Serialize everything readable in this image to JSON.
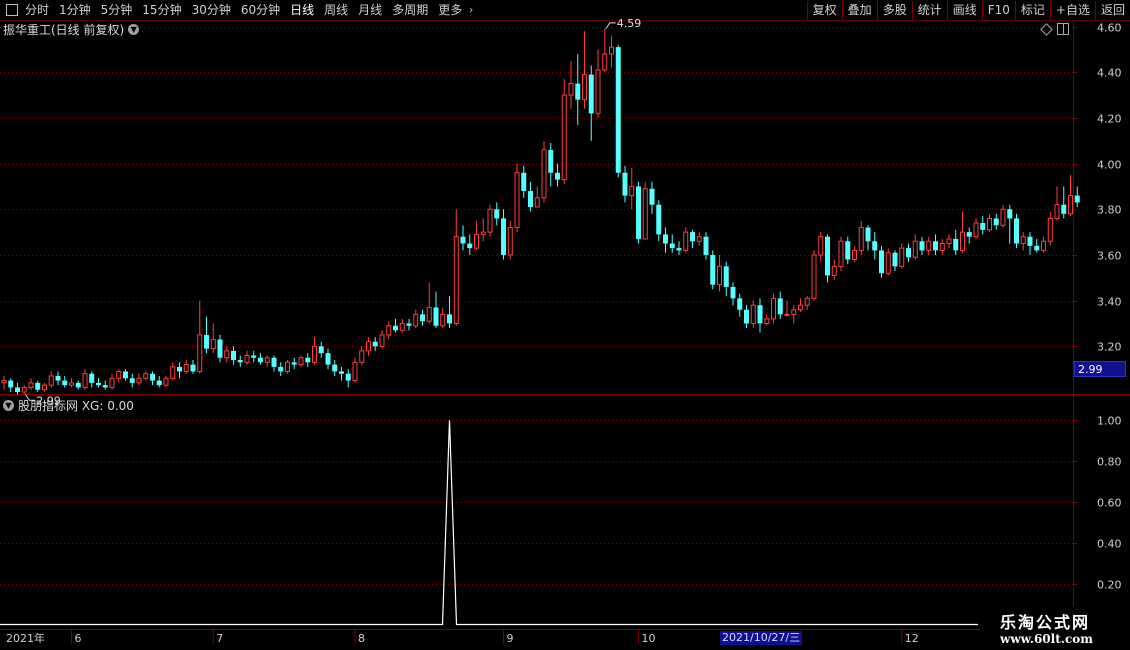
{
  "toolbar": {
    "left": [
      {
        "label": "分时"
      },
      {
        "label": "1分钟"
      },
      {
        "label": "5分钟"
      },
      {
        "label": "15分钟"
      },
      {
        "label": "30分钟"
      },
      {
        "label": "60分钟"
      },
      {
        "label": "日线",
        "active": true
      },
      {
        "label": "周线"
      },
      {
        "label": "月线"
      },
      {
        "label": "多周期"
      },
      {
        "label": "更多"
      }
    ],
    "right": [
      {
        "label": "复权"
      },
      {
        "label": "叠加"
      },
      {
        "label": "多股"
      },
      {
        "label": "统计"
      },
      {
        "label": "画线"
      },
      {
        "label": "F10"
      },
      {
        "label": "标记"
      },
      {
        "label": "+自选"
      },
      {
        "label": "返回"
      }
    ]
  },
  "main_panel": {
    "title": "振华重工(日线 前复权)",
    "price_tag": "2.99"
  },
  "sub_panel": {
    "title": "股朋指标网 XG: 0.00"
  },
  "date_axis": {
    "cursor_date": "2021/10/27/三"
  },
  "watermark": {
    "line1": "乐淘公式网",
    "line2": "www.60lt.com"
  },
  "colors": {
    "up": "#ff3c3c",
    "down": "#54ffff",
    "grid": "#800000",
    "axis_text": "#cfcfcf",
    "indicator_line": "#ffffff"
  },
  "chart_data": [
    {
      "type": "candlestick",
      "title": "振华重工(日线 前复权)",
      "y_ticks": [
        "3.20",
        "3.40",
        "3.60",
        "3.80",
        "4.00",
        "4.20",
        "4.40",
        "4.60"
      ],
      "ylim": [
        3.0,
        4.62
      ],
      "months": [
        {
          "label": "2021年",
          "index": 0
        },
        {
          "label": "6",
          "index": 10
        },
        {
          "label": "7",
          "index": 31
        },
        {
          "label": "8",
          "index": 52
        },
        {
          "label": "9",
          "index": 74
        },
        {
          "label": "10",
          "index": 94
        },
        {
          "label": "12",
          "index": 133
        }
      ],
      "annotations": [
        {
          "text": "4.59",
          "index": 89,
          "price": 4.59
        },
        {
          "text": "2.99",
          "index": 3,
          "price": 2.99
        }
      ],
      "candles": [
        [
          3.04,
          3.05,
          3.07,
          3.01
        ],
        [
          3.05,
          3.02,
          3.06,
          3.0
        ],
        [
          3.02,
          3.0,
          3.04,
          2.99
        ],
        [
          3.0,
          3.02,
          3.03,
          2.99
        ],
        [
          3.02,
          3.04,
          3.06,
          3.01
        ],
        [
          3.04,
          3.01,
          3.05,
          3.0
        ],
        [
          3.01,
          3.03,
          3.04,
          3.0
        ],
        [
          3.03,
          3.07,
          3.09,
          3.02
        ],
        [
          3.07,
          3.05,
          3.09,
          3.03
        ],
        [
          3.05,
          3.03,
          3.07,
          3.02
        ],
        [
          3.03,
          3.04,
          3.06,
          3.02
        ],
        [
          3.04,
          3.02,
          3.05,
          3.01
        ],
        [
          3.02,
          3.08,
          3.1,
          3.01
        ],
        [
          3.08,
          3.04,
          3.09,
          3.02
        ],
        [
          3.04,
          3.03,
          3.06,
          3.02
        ],
        [
          3.03,
          3.02,
          3.05,
          3.01
        ],
        [
          3.02,
          3.06,
          3.08,
          3.01
        ],
        [
          3.06,
          3.09,
          3.1,
          3.04
        ],
        [
          3.09,
          3.06,
          3.1,
          3.05
        ],
        [
          3.06,
          3.04,
          3.08,
          3.02
        ],
        [
          3.04,
          3.06,
          3.08,
          3.03
        ],
        [
          3.06,
          3.08,
          3.09,
          3.05
        ],
        [
          3.08,
          3.05,
          3.09,
          3.03
        ],
        [
          3.05,
          3.03,
          3.07,
          3.02
        ],
        [
          3.03,
          3.06,
          3.07,
          3.02
        ],
        [
          3.06,
          3.11,
          3.13,
          3.05
        ],
        [
          3.11,
          3.09,
          3.13,
          3.06
        ],
        [
          3.09,
          3.12,
          3.14,
          3.08
        ],
        [
          3.12,
          3.09,
          3.14,
          3.08
        ],
        [
          3.09,
          3.25,
          3.4,
          3.08
        ],
        [
          3.25,
          3.19,
          3.33,
          3.17
        ],
        [
          3.19,
          3.23,
          3.3,
          3.17
        ],
        [
          3.23,
          3.15,
          3.25,
          3.13
        ],
        [
          3.15,
          3.18,
          3.2,
          3.13
        ],
        [
          3.18,
          3.14,
          3.2,
          3.12
        ],
        [
          3.14,
          3.13,
          3.16,
          3.11
        ],
        [
          3.13,
          3.16,
          3.18,
          3.12
        ],
        [
          3.16,
          3.15,
          3.18,
          3.13
        ],
        [
          3.15,
          3.13,
          3.17,
          3.12
        ],
        [
          3.13,
          3.15,
          3.16,
          3.11
        ],
        [
          3.15,
          3.11,
          3.16,
          3.09
        ],
        [
          3.11,
          3.09,
          3.13,
          3.07
        ],
        [
          3.09,
          3.13,
          3.14,
          3.08
        ],
        [
          3.13,
          3.12,
          3.15,
          3.1
        ],
        [
          3.12,
          3.15,
          3.16,
          3.11
        ],
        [
          3.15,
          3.13,
          3.17,
          3.11
        ],
        [
          3.13,
          3.2,
          3.24,
          3.12
        ],
        [
          3.2,
          3.17,
          3.22,
          3.15
        ],
        [
          3.17,
          3.12,
          3.19,
          3.1
        ],
        [
          3.12,
          3.09,
          3.14,
          3.07
        ],
        [
          3.09,
          3.08,
          3.11,
          3.05
        ],
        [
          3.08,
          3.05,
          3.1,
          3.02
        ],
        [
          3.05,
          3.13,
          3.15,
          3.04
        ],
        [
          3.13,
          3.18,
          3.2,
          3.12
        ],
        [
          3.18,
          3.22,
          3.24,
          3.16
        ],
        [
          3.22,
          3.2,
          3.24,
          3.18
        ],
        [
          3.2,
          3.25,
          3.27,
          3.19
        ],
        [
          3.25,
          3.29,
          3.31,
          3.23
        ],
        [
          3.29,
          3.27,
          3.32,
          3.26
        ],
        [
          3.27,
          3.3,
          3.32,
          3.26
        ],
        [
          3.3,
          3.29,
          3.32,
          3.27
        ],
        [
          3.29,
          3.34,
          3.36,
          3.28
        ],
        [
          3.34,
          3.31,
          3.36,
          3.29
        ],
        [
          3.31,
          3.37,
          3.48,
          3.3
        ],
        [
          3.37,
          3.29,
          3.44,
          3.28
        ],
        [
          3.29,
          3.34,
          3.37,
          3.28
        ],
        [
          3.34,
          3.3,
          3.42,
          3.28
        ],
        [
          3.3,
          3.68,
          3.8,
          3.29
        ],
        [
          3.68,
          3.65,
          3.73,
          3.62
        ],
        [
          3.65,
          3.63,
          3.69,
          3.6
        ],
        [
          3.63,
          3.69,
          3.75,
          3.62
        ],
        [
          3.69,
          3.7,
          3.76,
          3.66
        ],
        [
          3.7,
          3.8,
          3.82,
          3.68
        ],
        [
          3.8,
          3.76,
          3.83,
          3.73
        ],
        [
          3.76,
          3.6,
          3.8,
          3.58
        ],
        [
          3.6,
          3.72,
          3.75,
          3.58
        ],
        [
          3.72,
          3.96,
          4.0,
          3.7
        ],
        [
          3.96,
          3.88,
          3.99,
          3.85
        ],
        [
          3.88,
          3.81,
          3.92,
          3.79
        ],
        [
          3.81,
          3.85,
          3.9,
          3.82
        ],
        [
          3.85,
          4.06,
          4.1,
          3.83
        ],
        [
          4.06,
          3.96,
          4.09,
          3.9
        ],
        [
          3.96,
          3.93,
          4.0,
          3.9
        ],
        [
          3.93,
          4.3,
          4.37,
          3.91
        ],
        [
          4.3,
          4.35,
          4.45,
          4.24
        ],
        [
          4.35,
          4.28,
          4.48,
          4.17
        ],
        [
          4.28,
          4.39,
          4.58,
          4.24
        ],
        [
          4.39,
          4.22,
          4.43,
          4.1
        ],
        [
          4.22,
          4.41,
          4.5,
          4.2
        ],
        [
          4.41,
          4.48,
          4.59,
          4.4
        ],
        [
          4.48,
          4.51,
          4.56,
          4.42
        ],
        [
          4.51,
          3.96,
          4.52,
          3.94
        ],
        [
          3.96,
          3.86,
          3.99,
          3.83
        ],
        [
          3.86,
          3.9,
          3.98,
          3.8
        ],
        [
          3.9,
          3.67,
          3.92,
          3.65
        ],
        [
          3.67,
          3.89,
          3.92,
          3.7
        ],
        [
          3.89,
          3.82,
          3.92,
          3.78
        ],
        [
          3.82,
          3.69,
          3.84,
          3.66
        ],
        [
          3.69,
          3.65,
          3.72,
          3.61
        ],
        [
          3.65,
          3.63,
          3.69,
          3.61
        ],
        [
          3.63,
          3.62,
          3.66,
          3.6
        ],
        [
          3.62,
          3.7,
          3.72,
          3.61
        ],
        [
          3.7,
          3.66,
          3.71,
          3.63
        ],
        [
          3.66,
          3.68,
          3.7,
          3.64
        ],
        [
          3.68,
          3.6,
          3.7,
          3.58
        ],
        [
          3.6,
          3.47,
          3.62,
          3.45
        ],
        [
          3.47,
          3.55,
          3.6,
          3.44
        ],
        [
          3.55,
          3.46,
          3.57,
          3.42
        ],
        [
          3.46,
          3.41,
          3.48,
          3.38
        ],
        [
          3.41,
          3.36,
          3.43,
          3.33
        ],
        [
          3.36,
          3.3,
          3.38,
          3.28
        ],
        [
          3.3,
          3.38,
          3.4,
          3.28
        ],
        [
          3.38,
          3.3,
          3.41,
          3.26
        ],
        [
          3.3,
          3.32,
          3.34,
          3.29
        ],
        [
          3.32,
          3.41,
          3.43,
          3.3
        ],
        [
          3.41,
          3.34,
          3.44,
          3.32
        ],
        [
          3.34,
          3.34,
          3.4,
          3.33
        ],
        [
          3.34,
          3.36,
          3.38,
          3.3
        ],
        [
          3.36,
          3.38,
          3.41,
          3.35
        ],
        [
          3.38,
          3.41,
          3.42,
          3.36
        ],
        [
          3.41,
          3.6,
          3.62,
          3.4
        ],
        [
          3.6,
          3.68,
          3.7,
          3.57
        ],
        [
          3.68,
          3.51,
          3.69,
          3.48
        ],
        [
          3.51,
          3.55,
          3.58,
          3.49
        ],
        [
          3.55,
          3.66,
          3.68,
          3.53
        ],
        [
          3.66,
          3.58,
          3.68,
          3.56
        ],
        [
          3.58,
          3.62,
          3.64,
          3.57
        ],
        [
          3.62,
          3.72,
          3.75,
          3.6
        ],
        [
          3.72,
          3.66,
          3.73,
          3.62
        ],
        [
          3.66,
          3.62,
          3.7,
          3.58
        ],
        [
          3.62,
          3.52,
          3.64,
          3.5
        ],
        [
          3.52,
          3.61,
          3.63,
          3.51
        ],
        [
          3.61,
          3.55,
          3.62,
          3.53
        ],
        [
          3.55,
          3.63,
          3.65,
          3.54
        ],
        [
          3.63,
          3.59,
          3.65,
          3.57
        ],
        [
          3.59,
          3.66,
          3.69,
          3.58
        ],
        [
          3.66,
          3.62,
          3.68,
          3.6
        ],
        [
          3.62,
          3.66,
          3.68,
          3.6
        ],
        [
          3.66,
          3.62,
          3.69,
          3.6
        ],
        [
          3.62,
          3.65,
          3.67,
          3.6
        ],
        [
          3.65,
          3.67,
          3.69,
          3.63
        ],
        [
          3.67,
          3.62,
          3.71,
          3.6
        ],
        [
          3.62,
          3.7,
          3.79,
          3.61
        ],
        [
          3.7,
          3.68,
          3.72,
          3.65
        ],
        [
          3.68,
          3.74,
          3.76,
          3.67
        ],
        [
          3.74,
          3.71,
          3.77,
          3.69
        ],
        [
          3.71,
          3.76,
          3.78,
          3.7
        ],
        [
          3.76,
          3.73,
          3.78,
          3.71
        ],
        [
          3.73,
          3.8,
          3.82,
          3.72
        ],
        [
          3.8,
          3.76,
          3.82,
          3.65
        ],
        [
          3.76,
          3.65,
          3.78,
          3.63
        ],
        [
          3.65,
          3.68,
          3.7,
          3.62
        ],
        [
          3.68,
          3.64,
          3.7,
          3.6
        ],
        [
          3.64,
          3.62,
          3.67,
          3.61
        ],
        [
          3.62,
          3.66,
          3.68,
          3.61
        ],
        [
          3.66,
          3.76,
          3.79,
          3.64
        ],
        [
          3.76,
          3.82,
          3.9,
          3.75
        ],
        [
          3.82,
          3.78,
          3.9,
          3.76
        ],
        [
          3.78,
          3.86,
          3.95,
          3.77
        ],
        [
          3.86,
          3.83,
          3.9,
          3.81
        ]
      ]
    },
    {
      "type": "line",
      "title": "股朋指标网 XG: 0.00",
      "y_ticks": [
        "0.20",
        "0.40",
        "0.60",
        "0.80",
        "1.00"
      ],
      "ylim": [
        0,
        1.05
      ],
      "series": [
        {
          "name": "XG",
          "spike_index": 66,
          "spike_value": 1.0,
          "baseline": 0.0
        }
      ]
    }
  ]
}
